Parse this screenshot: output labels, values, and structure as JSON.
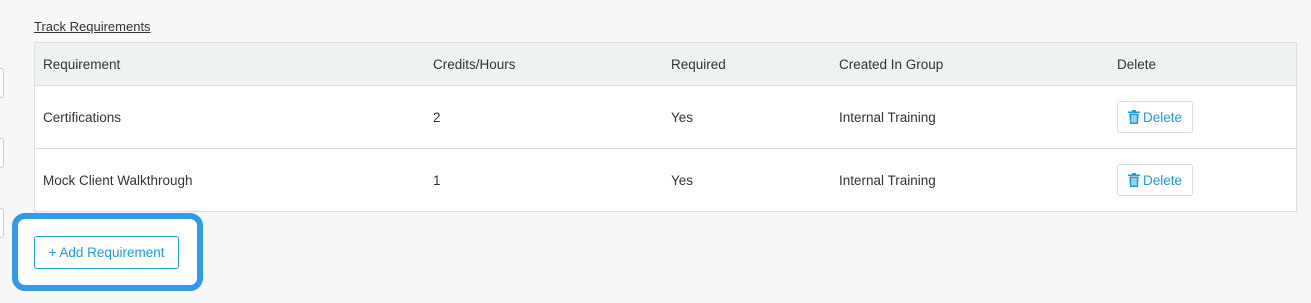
{
  "section": {
    "title": "Track Requirements"
  },
  "table": {
    "headers": [
      "Requirement",
      "Credits/Hours",
      "Required",
      "Created In Group",
      "Delete"
    ],
    "rows": [
      {
        "requirement": "Certifications",
        "credits": "2",
        "required": "Yes",
        "group": "Internal Training",
        "delete_label": "Delete"
      },
      {
        "requirement": "Mock Client Walkthrough",
        "credits": "1",
        "required": "Yes",
        "group": "Internal Training",
        "delete_label": "Delete"
      }
    ]
  },
  "actions": {
    "add_requirement_label": "+ Add Requirement"
  },
  "icons": {
    "delete": "trash-icon"
  },
  "colors": {
    "accent": "#1f9bd6",
    "highlight": "#2f9bea",
    "header_bg": "#eef3f1",
    "page_bg": "#f7f7f7"
  }
}
